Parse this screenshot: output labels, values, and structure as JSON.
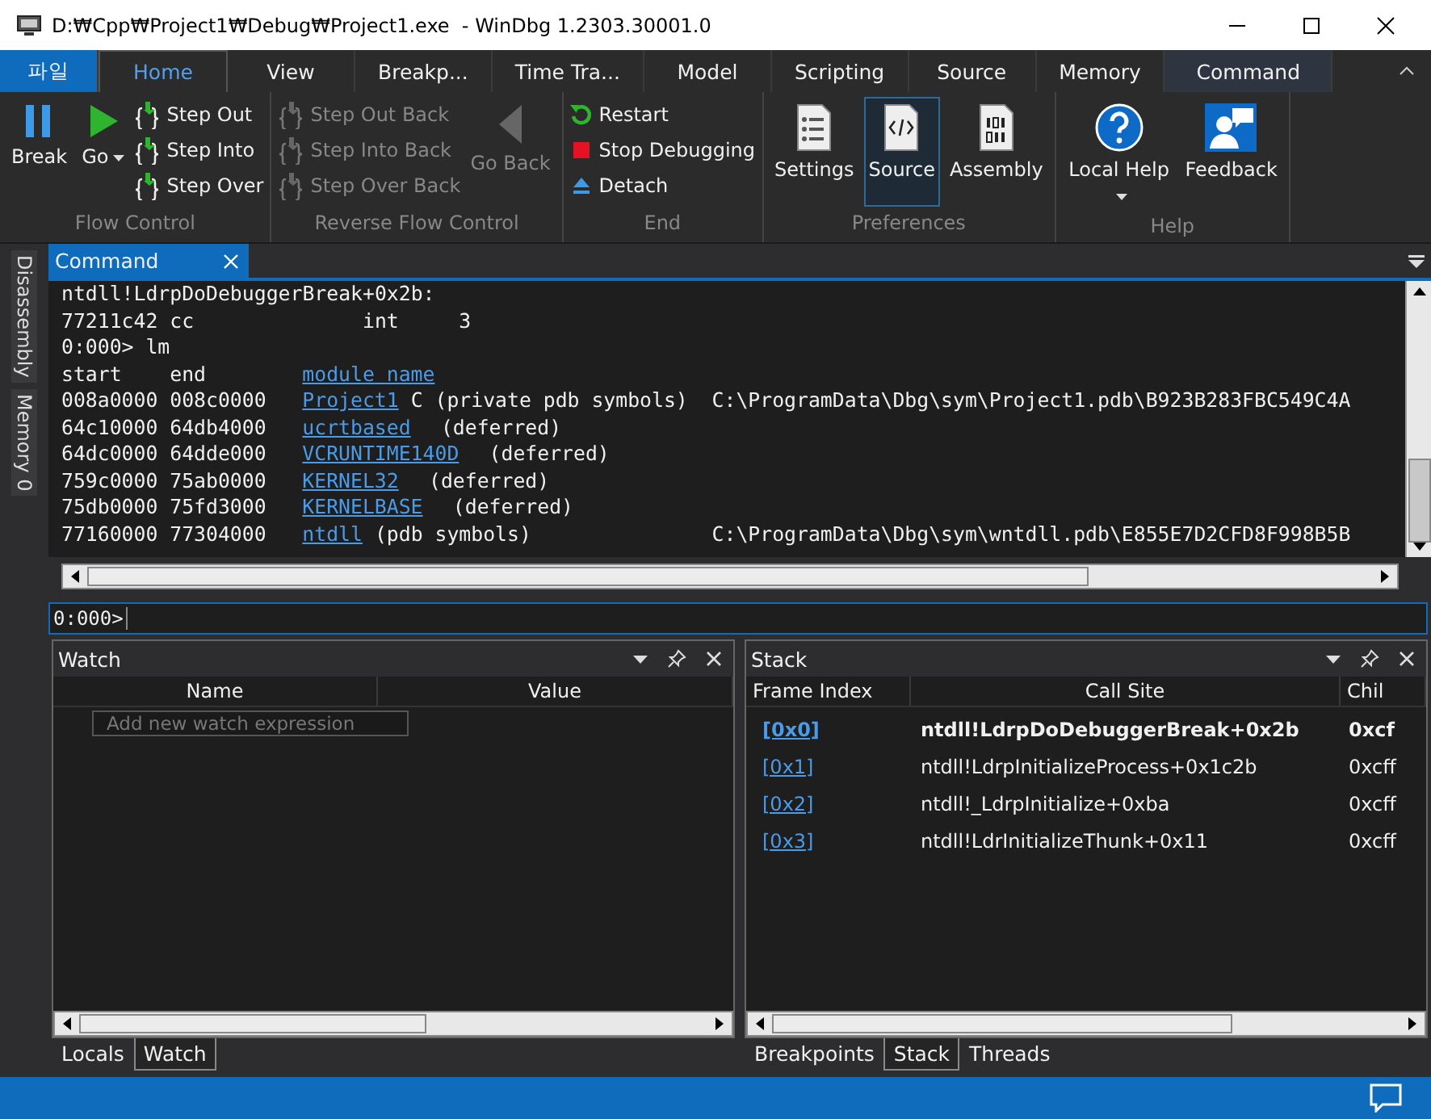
{
  "window": {
    "title": "D:₩Cpp₩Project1₩Debug₩Project1.exe  - WinDbg 1.2303.30001.0"
  },
  "ribbon_tabs": [
    {
      "label": "파일",
      "kind": "file",
      "selected": false
    },
    {
      "label": "Home",
      "kind": "tab",
      "selected": true
    },
    {
      "label": "View",
      "kind": "tab",
      "selected": false
    },
    {
      "label": "Breakp...",
      "kind": "tab",
      "selected": false
    },
    {
      "label": "Time Tra...",
      "kind": "tab",
      "selected": false
    },
    {
      "label": "Model",
      "kind": "tab",
      "selected": false
    },
    {
      "label": "Scripting",
      "kind": "tab",
      "selected": false
    },
    {
      "label": "Source",
      "kind": "tab",
      "selected": false
    },
    {
      "label": "Memory",
      "kind": "tab",
      "selected": false
    },
    {
      "label": "Command",
      "kind": "contextual",
      "selected": false
    }
  ],
  "ribbon_groups": [
    {
      "label": "Flow Control",
      "columns": [
        {
          "kind": "large",
          "label": "Break",
          "disabled": false,
          "selected": false
        },
        {
          "kind": "large",
          "label": "Go",
          "disabled": false,
          "selected": false,
          "dropdown": true
        },
        {
          "kind": "stack",
          "items": [
            {
              "label": "Step Out",
              "disabled": false
            },
            {
              "label": "Step Into",
              "disabled": false
            },
            {
              "label": "Step Over",
              "disabled": false
            }
          ]
        }
      ]
    },
    {
      "label": "Reverse Flow Control",
      "columns": [
        {
          "kind": "stack",
          "items": [
            {
              "label": "Step Out Back",
              "disabled": true
            },
            {
              "label": "Step Into Back",
              "disabled": true
            },
            {
              "label": "Step Over Back",
              "disabled": true
            }
          ]
        },
        {
          "kind": "large",
          "label": "Go Back",
          "disabled": true,
          "selected": false
        }
      ]
    },
    {
      "label": "End",
      "columns": [
        {
          "kind": "stack",
          "items": [
            {
              "label": "Restart",
              "disabled": false
            },
            {
              "label": "Stop Debugging",
              "disabled": false
            },
            {
              "label": "Detach",
              "disabled": false
            }
          ]
        }
      ]
    },
    {
      "label": "Preferences",
      "columns": [
        {
          "kind": "large",
          "label": "Settings",
          "disabled": false,
          "selected": false
        },
        {
          "kind": "large",
          "label": "Source",
          "disabled": false,
          "selected": true
        },
        {
          "kind": "large",
          "label": "Assembly",
          "disabled": false,
          "selected": false
        }
      ]
    },
    {
      "label": "Help",
      "columns": [
        {
          "kind": "large",
          "label": "Local Help",
          "disabled": false,
          "selected": false,
          "dropdown": true
        },
        {
          "kind": "large",
          "label": "Feedback",
          "disabled": false,
          "selected": false
        }
      ]
    }
  ],
  "side_tabs": [
    "Disassembly",
    "Memory 0"
  ],
  "command": {
    "tab": "Command",
    "lines": [
      {
        "kind": "text",
        "text": "ntdll!LdrpDoDebuggerBreak+0x2b:"
      },
      {
        "kind": "text",
        "text": "77211c42 cc              int     3"
      },
      {
        "kind": "text",
        "text": "0:000> lm"
      },
      {
        "kind": "header",
        "start": "start",
        "end": "end",
        "module": "module name"
      },
      {
        "kind": "module",
        "start": "008a0000",
        "end": "008c0000",
        "module": "Project1",
        "info": "C (private pdb symbols)",
        "path": "C:\\ProgramData\\Dbg\\sym\\Project1.pdb\\B923B283FBC549C4A"
      },
      {
        "kind": "module",
        "start": "64c10000",
        "end": "64db4000",
        "module": "ucrtbased",
        "info": "(deferred)"
      },
      {
        "kind": "module",
        "start": "64dc0000",
        "end": "64dde000",
        "module": "VCRUNTIME140D",
        "info": "(deferred)"
      },
      {
        "kind": "module",
        "start": "759c0000",
        "end": "75ab0000",
        "module": "KERNEL32",
        "info": "(deferred)"
      },
      {
        "kind": "module",
        "start": "75db0000",
        "end": "75fd3000",
        "module": "KERNELBASE",
        "info": "(deferred)"
      },
      {
        "kind": "module",
        "start": "77160000",
        "end": "77304000",
        "module": "ntdll",
        "info": "(pdb symbols)",
        "path": "C:\\ProgramData\\Dbg\\sym\\wntdll.pdb\\E855E7D2CFD8F998B5B"
      }
    ],
    "prompt": "0:000>"
  },
  "watch": {
    "title": "Watch",
    "columns": [
      "Name",
      "Value"
    ],
    "placeholder": "Add new watch expression",
    "tabs": [
      {
        "label": "Locals",
        "selected": false
      },
      {
        "label": "Watch",
        "selected": true
      }
    ]
  },
  "stack": {
    "title": "Stack",
    "columns": [
      "Frame Index",
      "Call Site",
      "Chil"
    ],
    "rows": [
      {
        "frame": "[0x0]",
        "call_site": "ntdll!LdrpDoDebuggerBreak+0x2b",
        "child": "0xcf",
        "current": true
      },
      {
        "frame": "[0x1]",
        "call_site": "ntdll!LdrpInitializeProcess+0x1c2b",
        "child": "0xcff",
        "current": false
      },
      {
        "frame": "[0x2]",
        "call_site": "ntdll!_LdrpInitialize+0xba",
        "child": "0xcff",
        "current": false
      },
      {
        "frame": "[0x3]",
        "call_site": "ntdll!LdrInitializeThunk+0x11",
        "child": "0xcff",
        "current": false
      }
    ],
    "tabs": [
      {
        "label": "Breakpoints",
        "selected": false
      },
      {
        "label": "Stack",
        "selected": true
      },
      {
        "label": "Threads",
        "selected": false
      }
    ]
  }
}
